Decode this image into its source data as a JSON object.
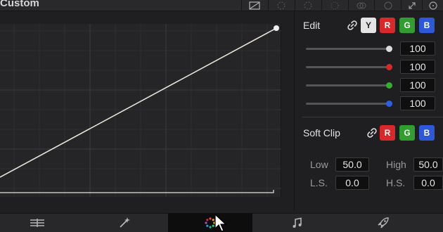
{
  "panel": {
    "title": "Custom"
  },
  "toolbar": {
    "icons": [
      "curve-mode-icon",
      "hue-vs-hue-icon",
      "hue-vs-sat-icon",
      "hue-vs-lum-icon",
      "lum-vs-sat-icon",
      "sat-vs-sat-icon",
      "expand-icon",
      "more-icon"
    ]
  },
  "edit": {
    "label": "Edit",
    "channels": [
      "Y",
      "R",
      "G",
      "B"
    ],
    "rows": [
      {
        "channel": "Y",
        "value": "100",
        "color": "#e4e4e4"
      },
      {
        "channel": "R",
        "value": "100",
        "color": "#d8282a"
      },
      {
        "channel": "G",
        "value": "100",
        "color": "#2f9e2e"
      },
      {
        "channel": "B",
        "value": "100",
        "color": "#2d58d8"
      }
    ]
  },
  "soft_clip": {
    "label": "Soft Clip",
    "channels": [
      "R",
      "G",
      "B"
    ],
    "low_label": "Low",
    "low_value": "50.0",
    "high_label": "High",
    "high_value": "50.0",
    "ls_label": "L.S.",
    "ls_value": "0.0",
    "hs_label": "H.S.",
    "hs_value": "0.0"
  },
  "pages": [
    {
      "name": "media-tab-icon",
      "glyph": "☰",
      "active": false
    },
    {
      "name": "magic-mask-tab-icon",
      "glyph": "✐",
      "active": false
    },
    {
      "name": "color-tab-icon",
      "glyph": "✺",
      "active": true
    },
    {
      "name": "fairlight-tab-icon",
      "glyph": "♫",
      "active": false
    },
    {
      "name": "deliver-tab-icon",
      "glyph": "➶",
      "active": false
    }
  ]
}
